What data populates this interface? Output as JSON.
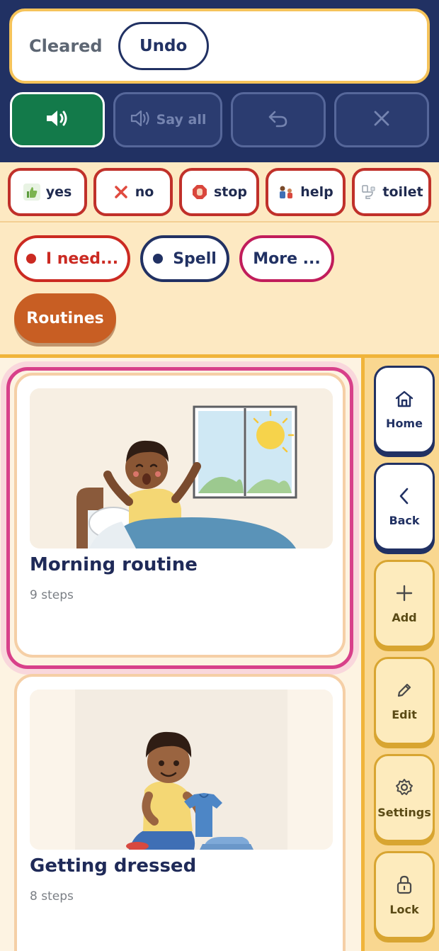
{
  "message_bar": {
    "status": "Cleared",
    "undo_label": "Undo"
  },
  "controls": {
    "say_all_label": "Say all"
  },
  "quick_chips": [
    {
      "label": "yes",
      "icon": "thumbs-up-icon"
    },
    {
      "label": "no",
      "icon": "x-mark-icon"
    },
    {
      "label": "stop",
      "icon": "stop-hand-icon"
    },
    {
      "label": "help",
      "icon": "help-person-icon"
    },
    {
      "label": "toilet",
      "icon": "toilet-icon"
    }
  ],
  "categories": {
    "need": "I need...",
    "spell": "Spell",
    "more": "More ...",
    "routines": "Routines"
  },
  "routines": [
    {
      "title": "Morning routine",
      "steps": "9 steps",
      "selected": true
    },
    {
      "title": "Getting dressed",
      "steps": "8 steps",
      "selected": false
    }
  ],
  "sidebar": {
    "home": "Home",
    "back": "Back",
    "add": "Add",
    "edit": "Edit",
    "settings": "Settings",
    "lock": "Lock"
  },
  "colors": {
    "navy": "#213163",
    "speak_green": "#137a4a",
    "chip_red": "#c0302a",
    "routines_orange": "#c85e23",
    "selected_pink": "#d8408a",
    "accent_gold": "#f0b43a"
  }
}
